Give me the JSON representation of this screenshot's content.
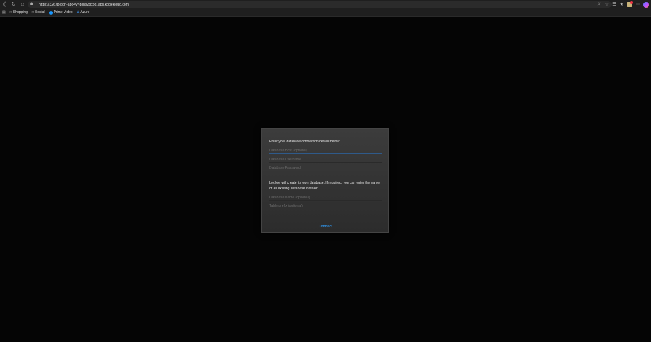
{
  "browser": {
    "url": "https://32678-port-apo4y7d8hs2bcog.labs.kodekloud.com",
    "bookmarks": [
      {
        "label": "Shopping"
      },
      {
        "label": "Social"
      },
      {
        "label": "Prime Video"
      },
      {
        "label": "Azure"
      }
    ]
  },
  "dialog": {
    "intro": "Enter your database connection details below:",
    "fields": {
      "host_placeholder": "Database Host (optional)",
      "username_placeholder": "Database Username",
      "password_placeholder": "Database Password",
      "dbname_placeholder": "Database Name (optional)",
      "prefix_placeholder": "Table prefix (optional)"
    },
    "note": "Lychee will create its own database. If required, you can enter the name of an existing database instead:",
    "connect_label": "Connect"
  },
  "colors": {
    "accent": "#2f8fe0",
    "dialog_bg": "#333333",
    "page_bg": "#050505"
  }
}
